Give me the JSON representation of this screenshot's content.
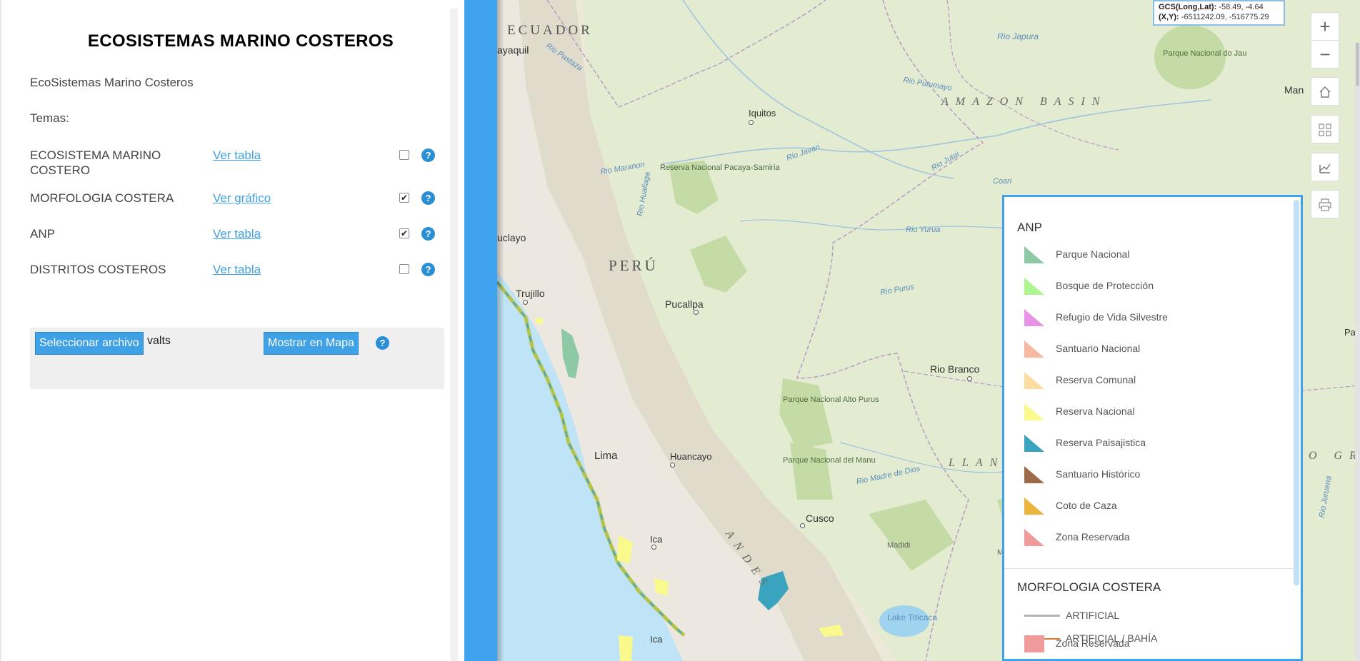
{
  "panel": {
    "title": "ECOSISTEMAS MARINO COSTEROS",
    "subtitle": "EcoSistemas Marino Costeros",
    "themes_label": "Temas:",
    "themes": [
      {
        "name": "ECOSISTEMA MARINO COSTERO",
        "link": "Ver tabla",
        "checked": false
      },
      {
        "name": "MORFOLOGIA COSTERA",
        "link": "Ver gráfico",
        "checked": true
      },
      {
        "name": "ANP",
        "link": "Ver tabla",
        "checked": true
      },
      {
        "name": "DISTRITOS COSTEROS",
        "link": "Ver tabla",
        "checked": false
      }
    ],
    "help_glyph": "?",
    "file": {
      "select_label": "Seleccionar archivo",
      "file_name": "valts",
      "show_label": "Mostrar en Mapa"
    }
  },
  "map": {
    "coords": {
      "gcs_label": "GCS(Long,Lat):",
      "gcs_value": "-58.49, -4.64",
      "xy_label": "(X,Y):",
      "xy_value": "-6511242.09, -516775.29"
    },
    "tools": [
      "zoom-in-icon",
      "zoom-out-icon",
      "home-icon",
      "grid-icon",
      "measure-icon",
      "print-icon"
    ],
    "labels": {
      "ecuador": "ECUADOR",
      "peru": "PERÚ",
      "amazon": "AMAZON BASIN",
      "llano": "LLANO",
      "andes": "ANDES",
      "gro": "O GRO",
      "iquitos": "Iquitos",
      "pucallpa": "Pucallpa",
      "trujillo": "Trujillo",
      "lima": "Lima",
      "huancayo": "Huancayo",
      "ica": "Ica",
      "ica2": "Ica",
      "cusco": "Cusco",
      "rio_branco": "Rio Branco",
      "madidi": "Madidi",
      "madidi2": "Madidi",
      "lake": "Lake Titicaca",
      "chiclayo": "uclayo",
      "guayaquil": "ayaquil",
      "man": "Man",
      "pa": "Pa",
      "park_jau": "Parque Nacional do Jau",
      "park_pacaya": "Reserva Nacional Pacaya-Samiria",
      "park_purus": "Parque Nacional Alto Purus",
      "park_manu": "Parque Nacional del Manu",
      "rio_japura": "Rio Japura",
      "rio_pastaza": "Rio Pastaza",
      "rio_putumayo": "Rio Putumayo",
      "rio_maranon": "Rio Maranon",
      "rio_huallaga": "Rio Huallaga",
      "rio_javari": "Rio Javari",
      "rio_jutai": "Rio Jutai",
      "rio_coari": "Coari",
      "rio_yurua": "Rio Yurua",
      "rio_purus": "Rio Purus",
      "rio_madre": "Rio Madre de Dios",
      "rio_juruena": "Rio Juruena"
    }
  },
  "legend": {
    "anp_title": "ANP",
    "anp_items": [
      {
        "label": "Parque Nacional",
        "color": "#8cc9a4"
      },
      {
        "label": "Bosque de Protección",
        "color": "#adf58f"
      },
      {
        "label": "Refugio de Vida Silvestre",
        "color": "#e693e6"
      },
      {
        "label": "Santuario Nacional",
        "color": "#f9b9a0"
      },
      {
        "label": "Reserva Comunal",
        "color": "#fddca0"
      },
      {
        "label": "Reserva Nacional",
        "color": "#fafa8c"
      },
      {
        "label": "Reserva Paisajistica",
        "color": "#3aa3bd"
      },
      {
        "label": "Santuario Histórico",
        "color": "#9e6a48"
      },
      {
        "label": "Coto de Caza",
        "color": "#ebb43c"
      },
      {
        "label": "Zona Reservada",
        "color": "#f09b9b"
      }
    ],
    "morfo_title": "MORFOLOGIA COSTERA",
    "morfo_items": [
      {
        "label": "ARTIFICIAL",
        "color": "#b4b4b4"
      },
      {
        "label": "ARTIFICIAL / BAHÍA",
        "color": "#e07b39"
      }
    ],
    "overlap_label": "Zona Reservada"
  }
}
